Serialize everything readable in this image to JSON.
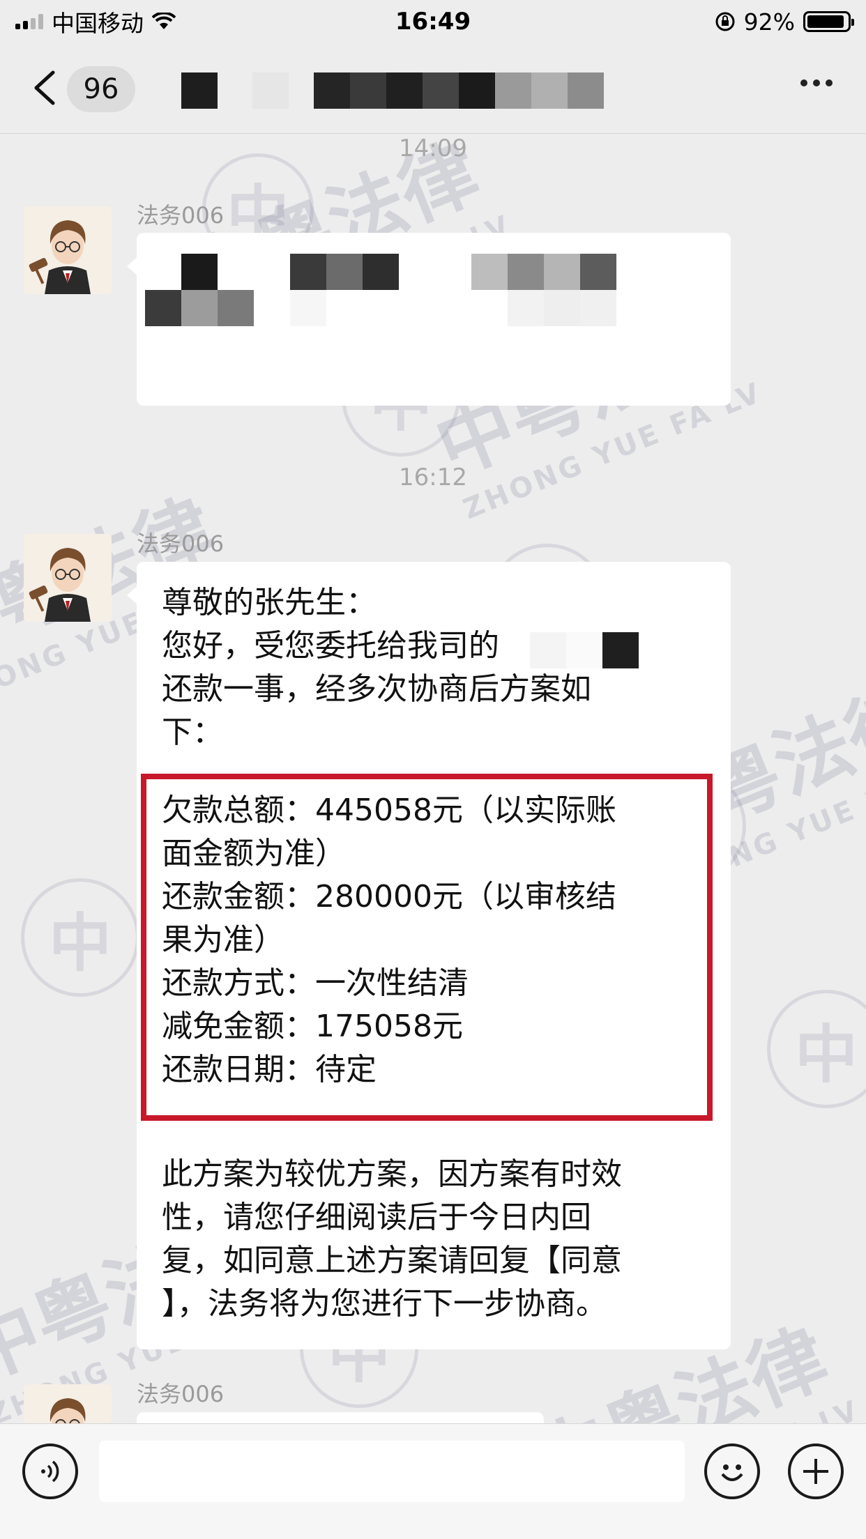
{
  "status_bar": {
    "carrier": "中国移动",
    "time": "16:49",
    "battery_percent": "92%",
    "battery_level": 0.92
  },
  "nav": {
    "unread_count": "96",
    "back_icon": "chevron-left-icon",
    "more_icon": "more-dots-icon"
  },
  "chat": {
    "timestamps": [
      "14:09",
      "16:12"
    ],
    "messages": [
      {
        "sender": "法务006",
        "content_redacted": true
      },
      {
        "sender": "法务006",
        "greeting": "尊敬的张先生：",
        "intro_line1": "您好，受您委托给我司的",
        "intro_line2": "还款一事，经多次协商后方案如",
        "intro_line3": "下：",
        "plan_lines": [
          "欠款总额：445058元（以实际账",
          "面金额为准）",
          "还款金额：280000元（以审核结",
          "果为准）",
          "还款方式：一次性结清",
          "减免金额：175058元",
          "还款日期：待定"
        ],
        "closing_lines": [
          "此方案为较优方案，因方案有时效",
          "性，请您仔细阅读后于今日内回",
          "复，如同意上述方案请回复【同意",
          "】，法务将为您进行下一步协商。"
        ]
      },
      {
        "sender": "法务006"
      }
    ]
  },
  "watermark": {
    "cn": "中粤法律",
    "en": "ZHONG YUE FA LV",
    "seal_char": "中"
  },
  "input_bar": {
    "voice_icon": "voice-icon",
    "emoji_icon": "emoji-icon",
    "plus_icon": "plus-icon",
    "placeholder": ""
  },
  "colors": {
    "background": "#ededed",
    "bubble": "#ffffff",
    "highlight_box": "#c8182b",
    "timestamp": "#a8a8a8"
  }
}
